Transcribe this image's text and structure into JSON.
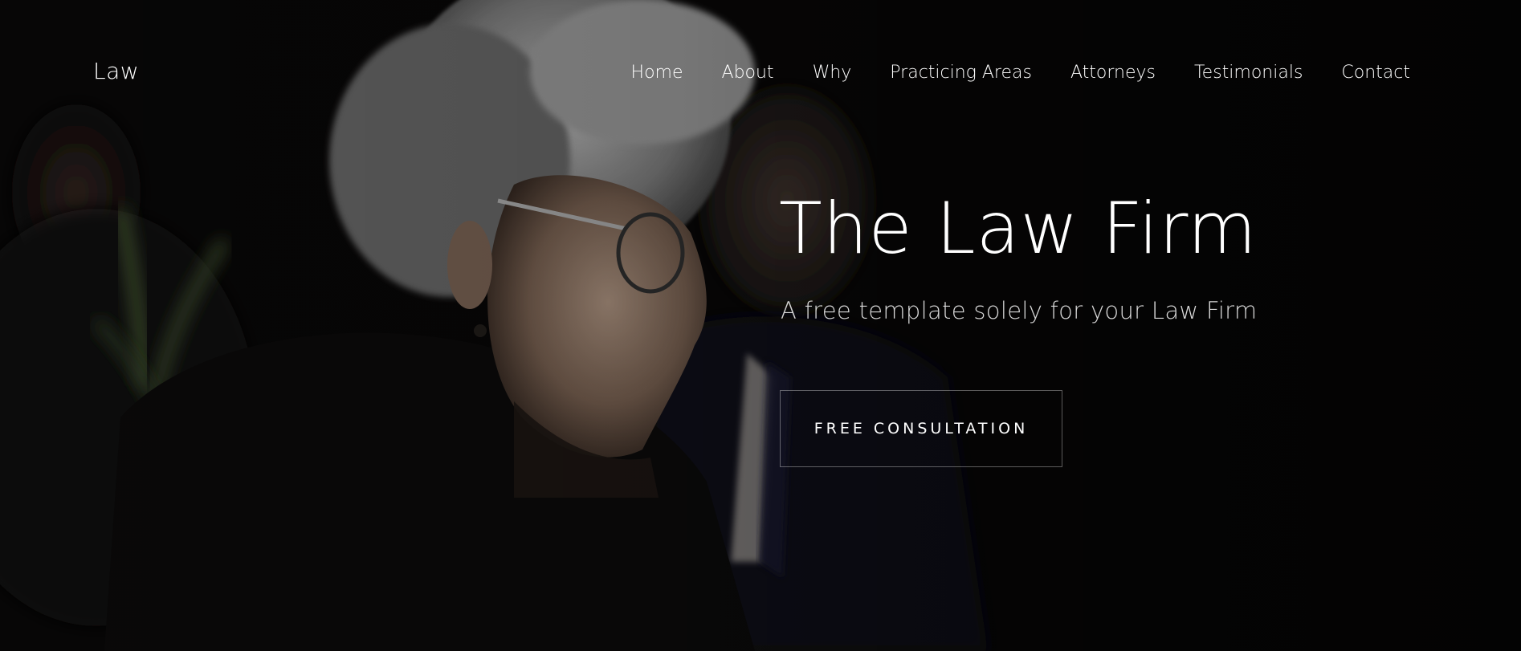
{
  "navbar": {
    "brand": "Law",
    "links": [
      {
        "label": "Home"
      },
      {
        "label": "About"
      },
      {
        "label": "Why"
      },
      {
        "label": "Practicing Areas"
      },
      {
        "label": "Attorneys"
      },
      {
        "label": "Testimonials"
      },
      {
        "label": "Contact"
      }
    ]
  },
  "hero": {
    "title": "The Law Firm",
    "subtitle": "A free template solely for your Law Firm",
    "cta_label": "FREE CONSULTATION",
    "background_image": "elderly-woman-with-glasses-photo"
  },
  "colors": {
    "background": "#050505",
    "text": "#ffffff",
    "subtitle": "#d8d8d8",
    "button_border": "rgba(255,255,255,0.35)"
  }
}
